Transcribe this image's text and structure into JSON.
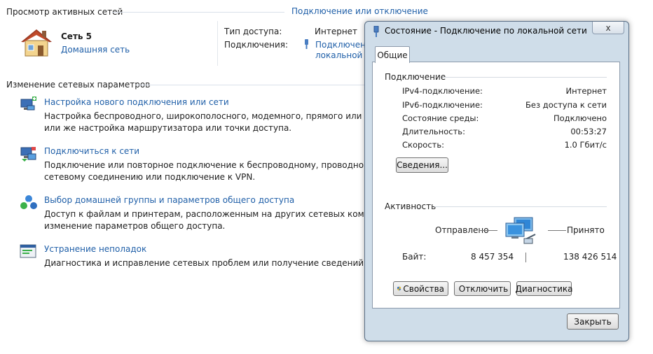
{
  "active_networks": {
    "header": "Просмотр активных сетей",
    "connect_link": "Подключение или отключение",
    "network_name": "Сеть  5",
    "network_type": "Домашняя сеть",
    "access_type_label": "Тип доступа:",
    "access_type_value": "Интернет",
    "connections_label": "Подключения:",
    "connection_link_line1": "Подключение",
    "connection_link_line2": "локальной с"
  },
  "change_settings": {
    "header": "Изменение сетевых параметров",
    "items": [
      {
        "title": "Настройка нового подключения или сети",
        "desc1": "Настройка беспроводного, широкополосного, модемного, прямого или VPN-под",
        "desc2": "или же настройка маршрутизатора или точки доступа.",
        "icon": "new-connection-icon"
      },
      {
        "title": "Подключиться к сети",
        "desc1": "Подключение или повторное подключение к беспроводному, проводному, моде",
        "desc2": "сетевому соединению или подключение к VPN.",
        "icon": "connect-network-icon"
      },
      {
        "title": "Выбор домашней группы и параметров общего доступа",
        "desc1": "Доступ к файлам и принтерам, расположенным на других сетевых компьютерах, и",
        "desc2": "изменение параметров общего доступа.",
        "icon": "homegroup-icon"
      },
      {
        "title": "Устранение неполадок",
        "desc1": "Диагностика и исправление сетевых проблем или получение сведений об исправ",
        "desc2": "",
        "icon": "troubleshoot-icon"
      }
    ]
  },
  "dialog": {
    "title": "Состояние - Подключение по локальной сети",
    "tab": "Общие",
    "connection_group": "Подключение",
    "rows": [
      {
        "key": "IPv4-подключение:",
        "value": "Интернет"
      },
      {
        "key": "IPv6-подключение:",
        "value": "Без доступа к сети"
      },
      {
        "key": "Состояние среды:",
        "value": "Подключено"
      },
      {
        "key": "Длительность:",
        "value": "00:53:27"
      },
      {
        "key": "Скорость:",
        "value": "1.0 Гбит/с"
      }
    ],
    "details_button": "Сведения...",
    "activity_group": "Активность",
    "sent_label": "Отправлено",
    "received_label": "Принято",
    "bytes_label": "Байт:",
    "bytes_sent": "8 457 354",
    "bytes_received": "138 426 514",
    "properties_button": "Свойства",
    "disable_button": "Отключить",
    "diagnose_button": "Диагностика",
    "close_button": "Закрыть",
    "close_x": "x"
  },
  "colors": {
    "link": "#1f5fa8",
    "dialog_frame": "#cfdde9"
  }
}
